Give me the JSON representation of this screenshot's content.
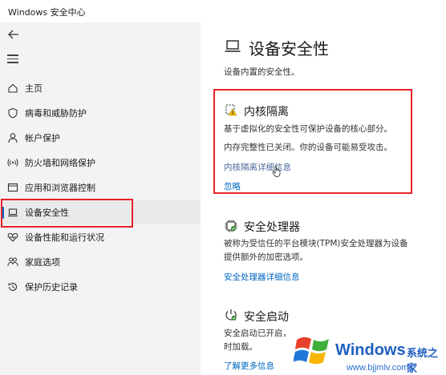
{
  "window": {
    "title": "Windows 安全中心"
  },
  "sidebar": {
    "items": [
      {
        "label": "主页",
        "icon": "home-icon"
      },
      {
        "label": "病毒和威胁防护",
        "icon": "shield-icon"
      },
      {
        "label": "帐户保护",
        "icon": "person-icon"
      },
      {
        "label": "防火墙和网络保护",
        "icon": "wifi-icon"
      },
      {
        "label": "应用和浏览器控制",
        "icon": "app-window-icon"
      },
      {
        "label": "设备安全性",
        "icon": "laptop-icon",
        "active": true
      },
      {
        "label": "设备性能和运行状况",
        "icon": "heart-icon"
      },
      {
        "label": "家庭选项",
        "icon": "family-icon"
      },
      {
        "label": "保护历史记录",
        "icon": "history-icon"
      }
    ]
  },
  "main": {
    "title": "设备安全性",
    "subtitle": "设备内置的安全性。",
    "core_isolation": {
      "title": "内核隔离",
      "line1": "基于虚拟化的安全性可保护设备的核心部分。",
      "line2": "内存完整性已关闭。你的设备可能易受攻击。",
      "details_link": "内核隔离详细信息",
      "ignore_link": "忽略"
    },
    "security_processor": {
      "title": "安全处理器",
      "line1": "被称为受信任的平台模块(TPM)安全处理器为设备",
      "line2": "提供额外的加密选项。",
      "details_link": "安全处理器详细信息"
    },
    "secure_boot": {
      "title": "安全启动",
      "line1": "安全启动已开启，",
      "line2": "时加载。",
      "more_link": "了解更多信息"
    }
  },
  "watermark": {
    "brand": "Windows",
    "cn": "系统之家",
    "url": "www.bjjmlv.com"
  },
  "colors": {
    "accent": "#0067c0",
    "highlight": "#e8212b",
    "sidebar_bg": "#f3f3f3"
  }
}
